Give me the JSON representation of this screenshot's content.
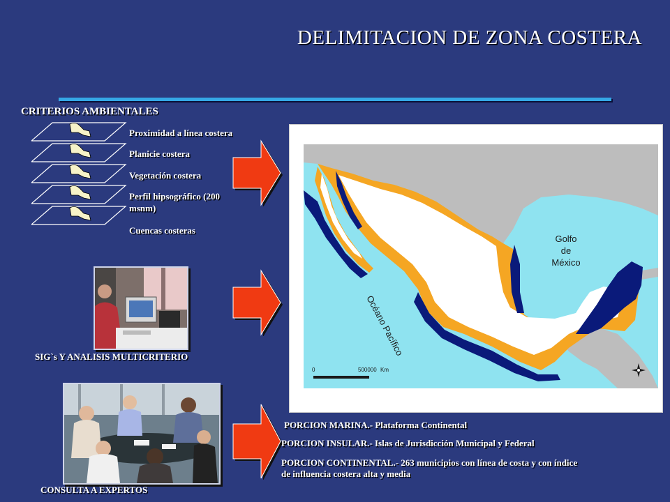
{
  "slide": {
    "title": "DELIMITACION DE ZONA COSTERA",
    "criteria_heading": "CRITERIOS AMBIENTALES",
    "criteria": [
      "Proximidad a línea costera",
      "Planicie costera",
      "Vegetación costera",
      "Perfil hipsográfico (200 msnm)",
      "Cuencas costeras"
    ],
    "gis_caption": "SIG`s Y ANALISIS MULTICRITERIO",
    "experts_caption": "CONSULTA A EXPERTOS",
    "portions": [
      "PORCION MARINA.- Plataforma Continental",
      "PORCION INSULAR.- Islas de Jurisdicción Municipal y Federal",
      "PORCION CONTINENTAL.- 263 municipios con línea de costa y con índice de influencia costera alta y media"
    ]
  },
  "map": {
    "gulf_label_line1": "Golfo",
    "gulf_label_line2": "de",
    "gulf_label_line3": "México",
    "ocean_label": "Océano Pacífico",
    "scale_start": "0",
    "scale_end": "500000",
    "scale_unit": "Km"
  },
  "colors": {
    "background": "#2b3a7e",
    "accent_bar": "#35a8e6",
    "arrow": "#f03a12",
    "ocean": "#8fe3f0",
    "land_other": "#bdbdbd",
    "coastal_zone": "#f5a623",
    "marine_platform": "#0a1a7a"
  },
  "icons": [
    "map-layer-icon",
    "right-arrow-icon",
    "compass-rose-icon"
  ]
}
